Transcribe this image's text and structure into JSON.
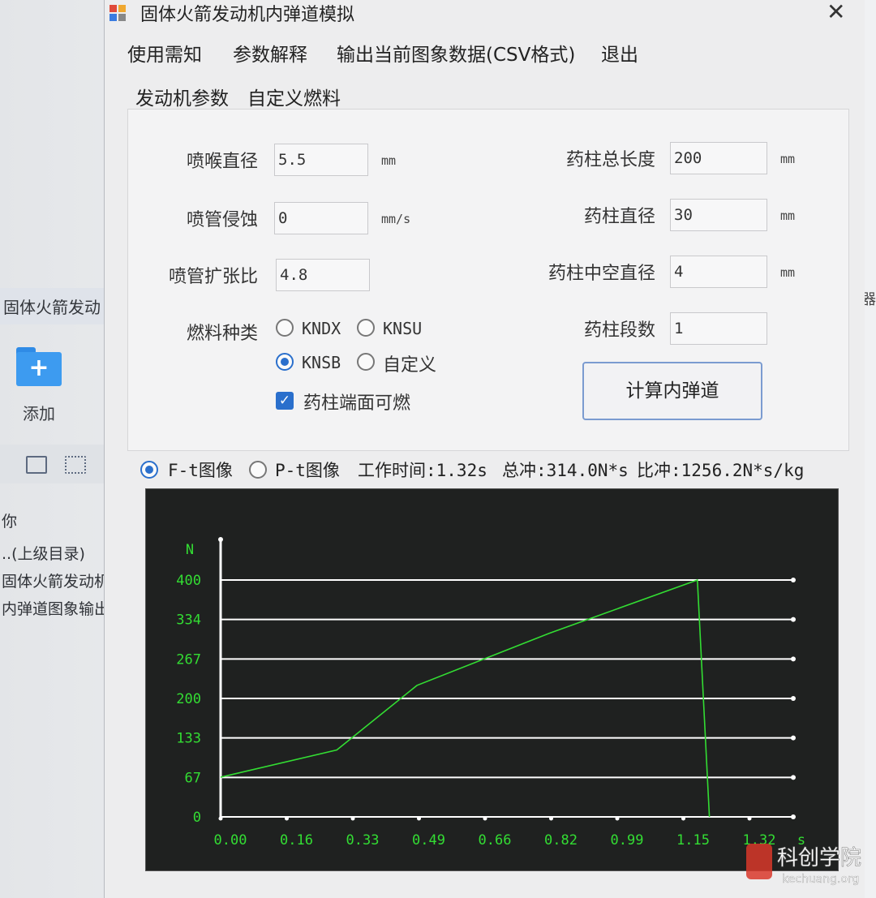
{
  "background": {
    "explorer_path": "固体火箭发动",
    "add_button_label": "添加",
    "list_items": [
      "..(上级目录)",
      "固体火箭发动机",
      "内弹道图象输出"
    ],
    "column_fragment": "你",
    "right_fragment": "器"
  },
  "window": {
    "title": "固体火箭发动机内弹道模拟",
    "close_glyph": "✕",
    "menu": [
      "使用需知",
      "参数解释",
      "输出当前图象数据(CSV格式)",
      "退出"
    ],
    "tabs": [
      {
        "label": "发动机参数",
        "active": true
      },
      {
        "label": "自定义燃料",
        "active": false
      }
    ]
  },
  "params": {
    "throat_diameter": {
      "label": "喷喉直径",
      "value": "5.5",
      "unit": "mm"
    },
    "nozzle_erosion": {
      "label": "喷管侵蚀",
      "value": "0",
      "unit": "mm/s"
    },
    "expansion_ratio": {
      "label": "喷管扩张比",
      "value": "4.8",
      "unit": ""
    },
    "grain_length": {
      "label": "药柱总长度",
      "value": "200",
      "unit": "mm"
    },
    "grain_diameter": {
      "label": "药柱直径",
      "value": "30",
      "unit": "mm"
    },
    "core_diameter": {
      "label": "药柱中空直径",
      "value": "4",
      "unit": "mm"
    },
    "grain_segments": {
      "label": "药柱段数",
      "value": "1"
    }
  },
  "fuel": {
    "label": "燃料种类",
    "options": [
      "KNDX",
      "KNSU",
      "KNSB",
      "自定义"
    ],
    "selected": "KNSB",
    "end_burning_label": "药柱端面可燃",
    "end_burning_checked": true
  },
  "calc_button_label": "计算内弹道",
  "results": {
    "mode_ft_label": "F-t图像",
    "mode_pt_label": "P-t图像",
    "selected_mode": "F-t图像",
    "burn_time": "工作时间:1.32s",
    "total_impulse": "总冲:314.0N*s",
    "specific_impulse": "比冲:1256.2N*s/kg"
  },
  "watermark": {
    "title": "科创学院",
    "url": "kechuang.org"
  },
  "colors": {
    "plot_line": "#33dd33",
    "axis_text": "#33dd33",
    "plot_bg": "#1f2120",
    "grid": "#ffffff",
    "accent": "#2a6fcc"
  },
  "chart_data": {
    "type": "line",
    "ylabel": "N",
    "xlabel": "s",
    "ylim": [
      0,
      400
    ],
    "xlim": [
      0,
      1.32
    ],
    "yticks": [
      "0",
      "67",
      "133",
      "200",
      "267",
      "334",
      "400"
    ],
    "xticks": [
      "0.00",
      "0.16",
      "0.33",
      "0.49",
      "0.66",
      "0.82",
      "0.99",
      "1.15",
      "1.32"
    ],
    "grid": true,
    "series": [
      {
        "x": [
          0.0,
          0.29,
          0.49,
          0.82,
          1.19,
          1.22
        ],
        "y": [
          67,
          113,
          222,
          310,
          400,
          0
        ]
      }
    ]
  }
}
